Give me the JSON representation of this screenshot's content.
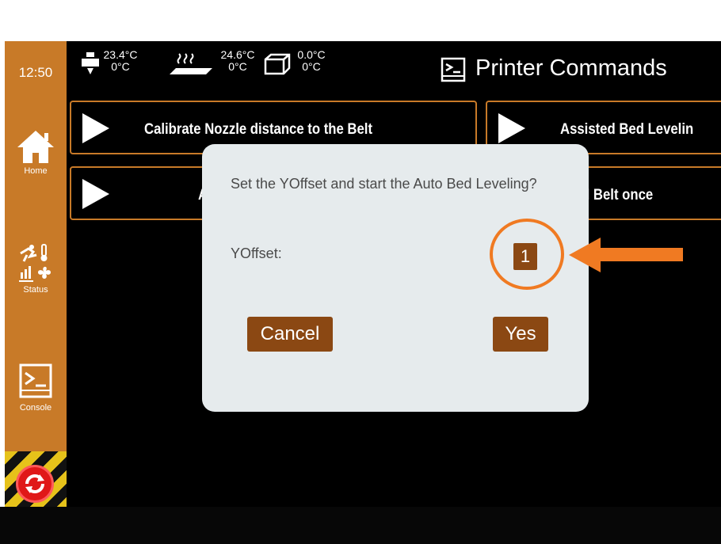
{
  "sidebar": {
    "clock": "12:50",
    "home_label": "Home",
    "status_label": "Status",
    "console_label": "Console"
  },
  "status_bar": {
    "extruder_temp": "23.4°C",
    "extruder_target": "0°C",
    "bed_temp": "24.6°C",
    "bed_target": "0°C",
    "chamber_temp": "0.0°C",
    "chamber_target": "0°C"
  },
  "header": {
    "title": "Printer Commands"
  },
  "commands": [
    {
      "label": "Calibrate Nozzle distance to the Belt"
    },
    {
      "label": "Assisted Bed Levelin"
    },
    {
      "label": "A"
    },
    {
      "label": "ll Belt once"
    }
  ],
  "dialog": {
    "message": "Set the YOffset and start the Auto Bed Leveling?",
    "yoffset_label": "YOffset:",
    "yoffset_value": "1",
    "cancel_label": "Cancel",
    "yes_label": "Yes"
  },
  "colors": {
    "accent": "#c87a28",
    "dialog_button": "#8b4813",
    "annotation": "#f07a22"
  }
}
